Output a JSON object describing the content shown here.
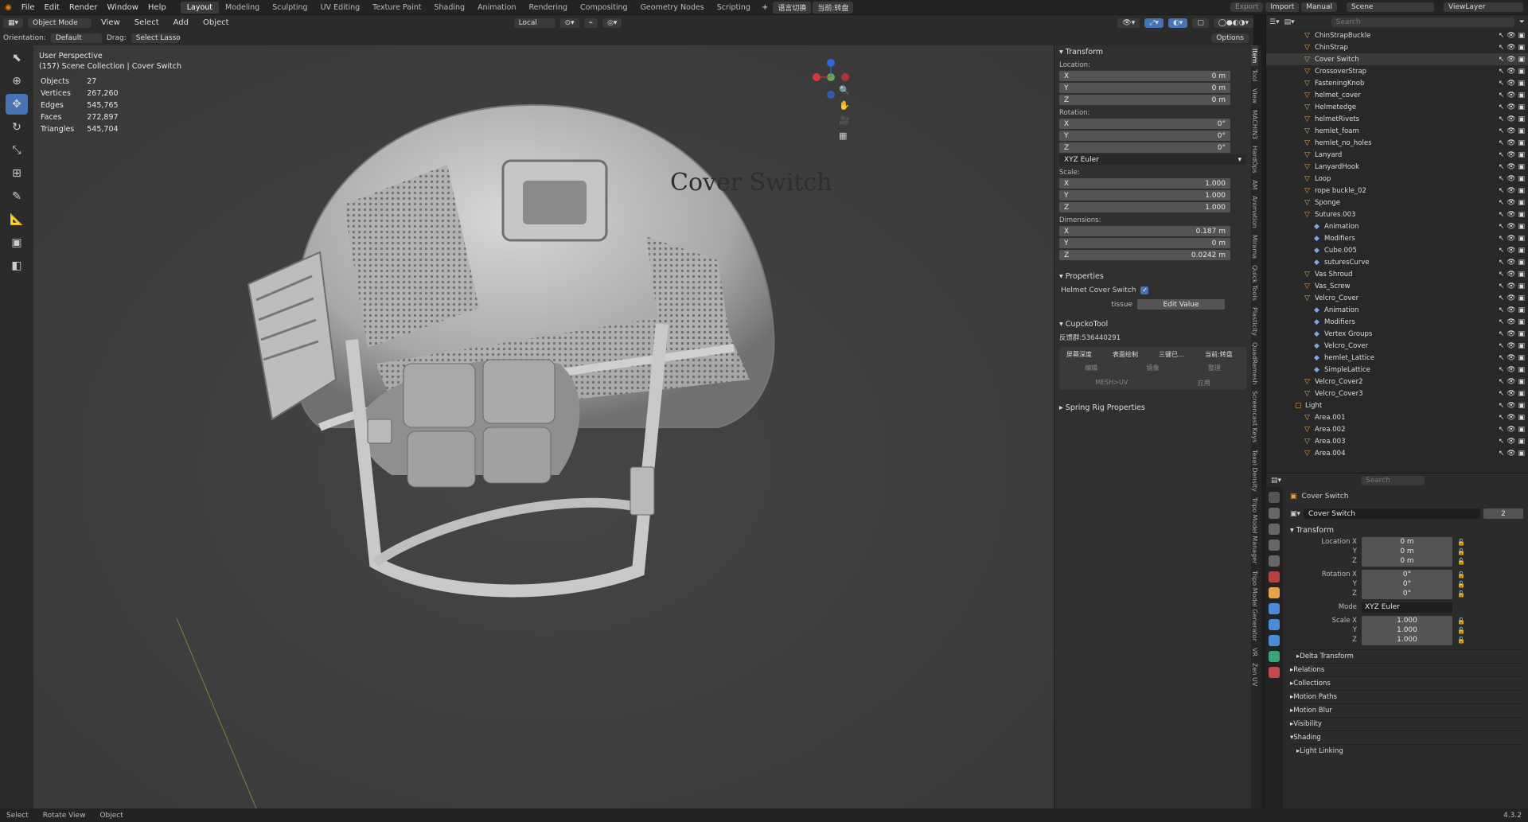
{
  "topbar": {
    "menus": [
      "File",
      "Edit",
      "Render",
      "Window",
      "Help"
    ],
    "workspaces": [
      "Layout",
      "Modeling",
      "Sculpting",
      "UV Editing",
      "Texture Paint",
      "Shading",
      "Animation",
      "Rendering",
      "Compositing",
      "Geometry Nodes",
      "Scripting"
    ],
    "active_workspace": "Layout",
    "lang_btn1": "语言切换",
    "lang_btn2": "当前:转盘",
    "export": "Export",
    "import": "Import",
    "manual": "Manual",
    "scene": "Scene",
    "viewlayer": "ViewLayer"
  },
  "header": {
    "mode": "Object Mode",
    "menus": [
      "View",
      "Select",
      "Add",
      "Object"
    ],
    "transform": "Local",
    "orientation_label": "Orientation:",
    "orientation_value": "Default",
    "drag_label": "Drag:",
    "drag_value": "Select Lasso",
    "options": "Options"
  },
  "stats": {
    "perspective": "User Perspective",
    "collection": "(157) Scene Collection | Cover Switch",
    "rows": [
      {
        "k": "Objects",
        "v": "27"
      },
      {
        "k": "Vertices",
        "v": "267,260"
      },
      {
        "k": "Edges",
        "v": "545,765"
      },
      {
        "k": "Faces",
        "v": "272,897"
      },
      {
        "k": "Triangles",
        "v": "545,704"
      }
    ]
  },
  "viewport": {
    "overlay_text": "Cover Switch"
  },
  "npanel": {
    "transform_title": "Transform",
    "location_label": "Location:",
    "location": [
      {
        "a": "X",
        "v": "0 m"
      },
      {
        "a": "Y",
        "v": "0 m"
      },
      {
        "a": "Z",
        "v": "0 m"
      }
    ],
    "rotation_label": "Rotation:",
    "rotation": [
      {
        "a": "X",
        "v": "0°"
      },
      {
        "a": "Y",
        "v": "0°"
      },
      {
        "a": "Z",
        "v": "0°"
      }
    ],
    "rotation_mode": "XYZ Euler",
    "scale_label": "Scale:",
    "scale": [
      {
        "a": "X",
        "v": "1.000"
      },
      {
        "a": "Y",
        "v": "1.000"
      },
      {
        "a": "Z",
        "v": "1.000"
      }
    ],
    "dimensions_label": "Dimensions:",
    "dimensions": [
      {
        "a": "X",
        "v": "0.187 m"
      },
      {
        "a": "Y",
        "v": "0 m"
      },
      {
        "a": "Z",
        "v": "0.0242 m"
      }
    ],
    "properties_title": "Properties",
    "helmet_cover_switch": "Helmet Cover Switch",
    "tissue_label": "tissue",
    "edit_value": "Edit Value",
    "cupcko_title": "CupckoTool",
    "group_text": "反馈群:536440291",
    "cupcko_btns": [
      "屏幕深度",
      "表面绘制",
      "三键已...",
      "当前:转盘"
    ],
    "cupcko_btns2": [
      "编辑",
      "镜像",
      "整理"
    ],
    "mesh_uv": "MESH>UV",
    "apply": "应用",
    "spring_title": "Spring Rig Properties"
  },
  "vtabs": [
    "Item",
    "Tool",
    "View",
    "MACHIN3",
    "HardOps",
    "AM",
    "Animation",
    "Mirama",
    "Quick Tools",
    "Plasticity",
    "QuadRemesh",
    "Screencast Keys",
    "Texel Density",
    "Tripo Model Manager",
    "Tripo Model Generator",
    "VR",
    "Zen UV"
  ],
  "outliner": {
    "search": "Search",
    "rows": [
      {
        "n": "ChinStrapBuckle",
        "d": 1
      },
      {
        "n": "ChinStrap",
        "d": 1
      },
      {
        "n": "Cover Switch",
        "d": 1
      },
      {
        "n": "CrossoverStrap",
        "d": 1
      },
      {
        "n": "FasteningKnob",
        "d": 1
      },
      {
        "n": "helmet_cover",
        "d": 1
      },
      {
        "n": "Helmetedge",
        "d": 1
      },
      {
        "n": "helmetRivets",
        "d": 1
      },
      {
        "n": "hemlet_foam",
        "d": 1
      },
      {
        "n": "hemlet_no_holes",
        "d": 1
      },
      {
        "n": "Lanyard",
        "d": 1
      },
      {
        "n": "LanyardHook",
        "d": 1
      },
      {
        "n": "Loop",
        "d": 1
      },
      {
        "n": "rope buckle_02",
        "d": 1
      },
      {
        "n": "Sponge",
        "d": 1
      },
      {
        "n": "Sutures.003",
        "d": 1
      },
      {
        "n": "Animation",
        "d": 2
      },
      {
        "n": "Modifiers",
        "d": 2
      },
      {
        "n": "Cube.005",
        "d": 2
      },
      {
        "n": "suturesCurve",
        "d": 2
      },
      {
        "n": "Vas Shroud",
        "d": 1
      },
      {
        "n": "Vas_Screw",
        "d": 1
      },
      {
        "n": "Velcro_Cover",
        "d": 1
      },
      {
        "n": "Animation",
        "d": 2
      },
      {
        "n": "Modifiers",
        "d": 2
      },
      {
        "n": "Vertex Groups",
        "d": 2
      },
      {
        "n": "Velcro_Cover",
        "d": 2
      },
      {
        "n": "hemlet_Lattice",
        "d": 2
      },
      {
        "n": "SimpleLattice",
        "d": 2
      },
      {
        "n": "Velcro_Cover2",
        "d": 1
      },
      {
        "n": "Velcro_Cover3",
        "d": 1
      },
      {
        "n": "Light",
        "d": 0
      },
      {
        "n": "Area.001",
        "d": 1
      },
      {
        "n": "Area.002",
        "d": 1
      },
      {
        "n": "Area.003",
        "d": 1
      },
      {
        "n": "Area.004",
        "d": 1
      }
    ]
  },
  "properties": {
    "search": "Search",
    "object_name": "Cover Switch",
    "data_name": "Cover Switch",
    "users": "2",
    "transform_title": "Transform",
    "loc_label": "Location X",
    "loc": [
      "0 m",
      "0 m",
      "0 m"
    ],
    "rot_label": "Rotation X",
    "rot": [
      "0°",
      "0°",
      "0°"
    ],
    "mode_label": "Mode",
    "mode_value": "XYZ Euler",
    "scale_label": "Scale X",
    "scale": [
      "1.000",
      "1.000",
      "1.000"
    ],
    "axis_y": "Y",
    "axis_z": "Z",
    "sections": [
      "Delta Transform",
      "Relations",
      "Collections",
      "Motion Paths",
      "Motion Blur",
      "Visibility",
      "Shading",
      "Light Linking"
    ]
  },
  "status": {
    "items": [
      "Select",
      "Rotate View",
      "Object"
    ],
    "version": "4.3.2"
  }
}
